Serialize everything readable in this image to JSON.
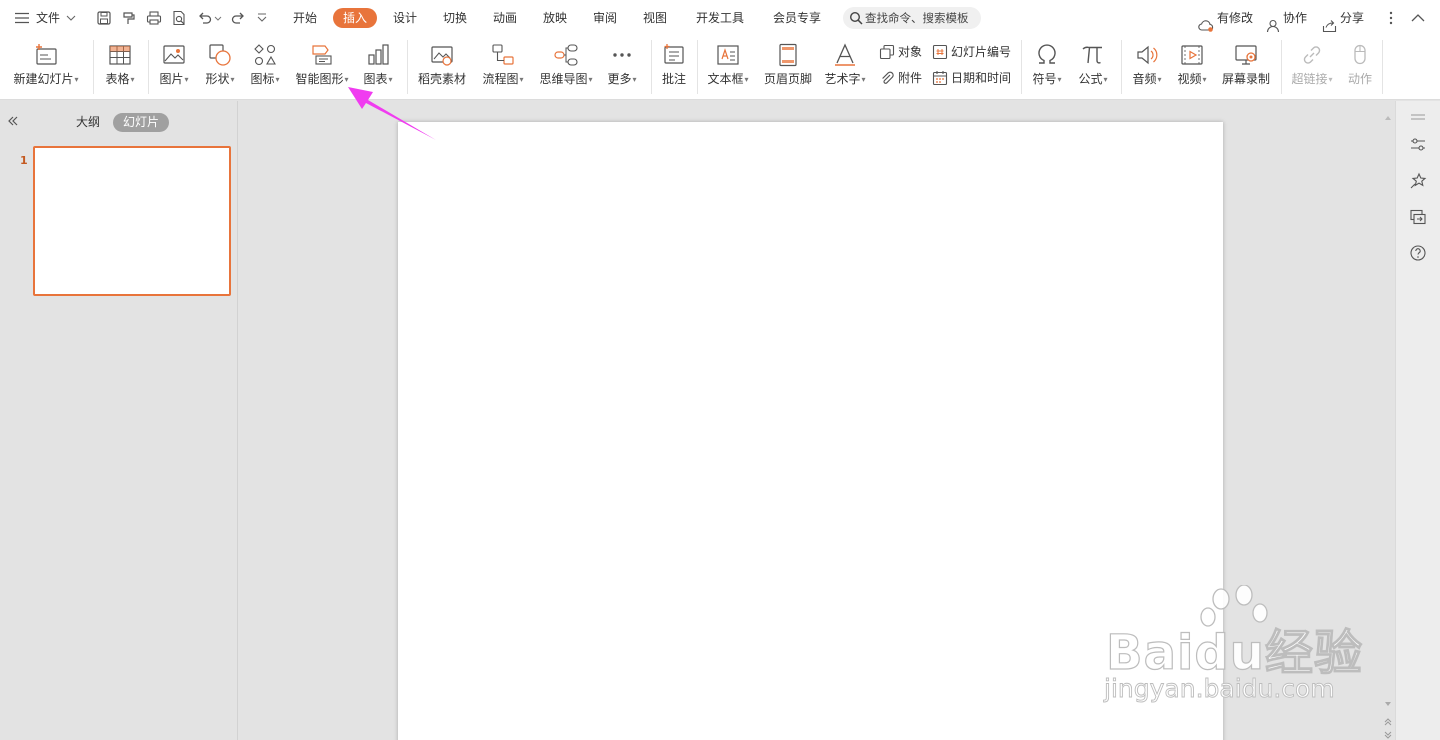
{
  "menu": {
    "file_label": "文件",
    "tabs": [
      {
        "label": "开始"
      },
      {
        "label": "插入",
        "active": true
      },
      {
        "label": "设计"
      },
      {
        "label": "切换"
      },
      {
        "label": "动画"
      },
      {
        "label": "放映"
      },
      {
        "label": "审阅"
      },
      {
        "label": "视图"
      },
      {
        "label": "开发工具"
      },
      {
        "label": "会员专享"
      }
    ],
    "search_placeholder": "查找命令、搜索模板",
    "right": {
      "unsaved_label": "有修改",
      "collab_label": "协作",
      "share_label": "分享"
    }
  },
  "ribbon": {
    "new_slide": "新建幻灯片",
    "table": "表格",
    "picture": "图片",
    "shape": "形状",
    "icon": "图标",
    "smartart": "智能图形",
    "chart": "图表",
    "material": "稻壳素材",
    "flowchart": "流程图",
    "mindmap": "思维导图",
    "more": "更多",
    "comment": "批注",
    "textbox": "文本框",
    "header_footer": "页眉页脚",
    "wordart": "艺术字",
    "object": "对象",
    "attachment": "附件",
    "slide_number": "幻灯片编号",
    "date_time": "日期和时间",
    "symbol": "符号",
    "formula": "公式",
    "audio": "音频",
    "video": "视频",
    "screen_record": "屏幕录制",
    "hyperlink": "超链接",
    "action": "动作"
  },
  "left_pane": {
    "outline_tab": "大纲",
    "slides_tab": "幻灯片",
    "slide_numbers": [
      "1"
    ]
  },
  "watermark": {
    "brand": "Baidu经验",
    "url": "jingyan.baidu.com"
  },
  "colors": {
    "accent": "#e8743b",
    "annotation_arrow": "#f03cf0"
  }
}
